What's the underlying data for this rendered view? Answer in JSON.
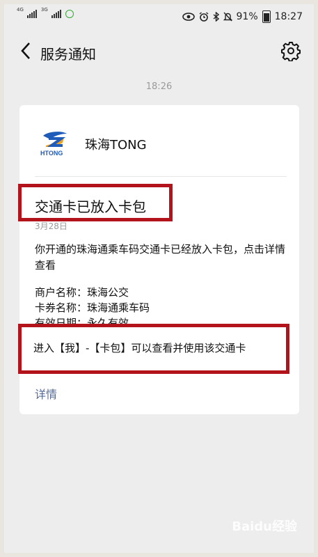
{
  "status_bar": {
    "network_1": "4G",
    "network_2": "3G",
    "battery": "91%",
    "time": "18:27"
  },
  "header": {
    "title": "服务通知",
    "back_icon": "chevron-left-icon",
    "settings_icon": "gear-icon"
  },
  "message_time": "18:26",
  "card": {
    "service_name": "珠海TONG",
    "logo_text": "HTONG",
    "title": "交通卡已放入卡包",
    "date": "3月28日",
    "intro": "你开通的珠海通乘车码交通卡已经放入卡包，点击详情查看",
    "merchant_label": "商户名称：",
    "merchant_value": "珠海公交",
    "card_label": "卡券名称：",
    "card_value": "珠海通乘车码",
    "validity_label": "有效日期：",
    "validity_value": "永久有效",
    "tip": "进入【我】-【卡包】可以查看并使用该交通卡",
    "detail_link": "详情"
  },
  "watermark": "Baidu经验",
  "colors": {
    "highlight_border": "#b3141c",
    "link": "#576b95",
    "page_background": "#ededed"
  }
}
